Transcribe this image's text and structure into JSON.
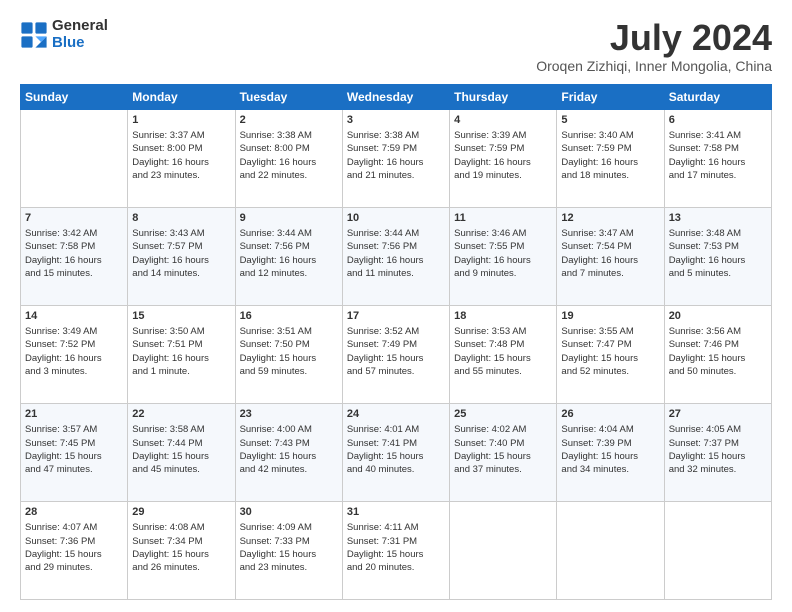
{
  "logo": {
    "text_general": "General",
    "text_blue": "Blue"
  },
  "title": "July 2024",
  "subtitle": "Oroqen Zizhiqi, Inner Mongolia, China",
  "weekdays": [
    "Sunday",
    "Monday",
    "Tuesday",
    "Wednesday",
    "Thursday",
    "Friday",
    "Saturday"
  ],
  "weeks": [
    [
      {
        "day": "",
        "content": ""
      },
      {
        "day": "1",
        "content": "Sunrise: 3:37 AM\nSunset: 8:00 PM\nDaylight: 16 hours\nand 23 minutes."
      },
      {
        "day": "2",
        "content": "Sunrise: 3:38 AM\nSunset: 8:00 PM\nDaylight: 16 hours\nand 22 minutes."
      },
      {
        "day": "3",
        "content": "Sunrise: 3:38 AM\nSunset: 7:59 PM\nDaylight: 16 hours\nand 21 minutes."
      },
      {
        "day": "4",
        "content": "Sunrise: 3:39 AM\nSunset: 7:59 PM\nDaylight: 16 hours\nand 19 minutes."
      },
      {
        "day": "5",
        "content": "Sunrise: 3:40 AM\nSunset: 7:59 PM\nDaylight: 16 hours\nand 18 minutes."
      },
      {
        "day": "6",
        "content": "Sunrise: 3:41 AM\nSunset: 7:58 PM\nDaylight: 16 hours\nand 17 minutes."
      }
    ],
    [
      {
        "day": "7",
        "content": "Sunrise: 3:42 AM\nSunset: 7:58 PM\nDaylight: 16 hours\nand 15 minutes."
      },
      {
        "day": "8",
        "content": "Sunrise: 3:43 AM\nSunset: 7:57 PM\nDaylight: 16 hours\nand 14 minutes."
      },
      {
        "day": "9",
        "content": "Sunrise: 3:44 AM\nSunset: 7:56 PM\nDaylight: 16 hours\nand 12 minutes."
      },
      {
        "day": "10",
        "content": "Sunrise: 3:44 AM\nSunset: 7:56 PM\nDaylight: 16 hours\nand 11 minutes."
      },
      {
        "day": "11",
        "content": "Sunrise: 3:46 AM\nSunset: 7:55 PM\nDaylight: 16 hours\nand 9 minutes."
      },
      {
        "day": "12",
        "content": "Sunrise: 3:47 AM\nSunset: 7:54 PM\nDaylight: 16 hours\nand 7 minutes."
      },
      {
        "day": "13",
        "content": "Sunrise: 3:48 AM\nSunset: 7:53 PM\nDaylight: 16 hours\nand 5 minutes."
      }
    ],
    [
      {
        "day": "14",
        "content": "Sunrise: 3:49 AM\nSunset: 7:52 PM\nDaylight: 16 hours\nand 3 minutes."
      },
      {
        "day": "15",
        "content": "Sunrise: 3:50 AM\nSunset: 7:51 PM\nDaylight: 16 hours\nand 1 minute."
      },
      {
        "day": "16",
        "content": "Sunrise: 3:51 AM\nSunset: 7:50 PM\nDaylight: 15 hours\nand 59 minutes."
      },
      {
        "day": "17",
        "content": "Sunrise: 3:52 AM\nSunset: 7:49 PM\nDaylight: 15 hours\nand 57 minutes."
      },
      {
        "day": "18",
        "content": "Sunrise: 3:53 AM\nSunset: 7:48 PM\nDaylight: 15 hours\nand 55 minutes."
      },
      {
        "day": "19",
        "content": "Sunrise: 3:55 AM\nSunset: 7:47 PM\nDaylight: 15 hours\nand 52 minutes."
      },
      {
        "day": "20",
        "content": "Sunrise: 3:56 AM\nSunset: 7:46 PM\nDaylight: 15 hours\nand 50 minutes."
      }
    ],
    [
      {
        "day": "21",
        "content": "Sunrise: 3:57 AM\nSunset: 7:45 PM\nDaylight: 15 hours\nand 47 minutes."
      },
      {
        "day": "22",
        "content": "Sunrise: 3:58 AM\nSunset: 7:44 PM\nDaylight: 15 hours\nand 45 minutes."
      },
      {
        "day": "23",
        "content": "Sunrise: 4:00 AM\nSunset: 7:43 PM\nDaylight: 15 hours\nand 42 minutes."
      },
      {
        "day": "24",
        "content": "Sunrise: 4:01 AM\nSunset: 7:41 PM\nDaylight: 15 hours\nand 40 minutes."
      },
      {
        "day": "25",
        "content": "Sunrise: 4:02 AM\nSunset: 7:40 PM\nDaylight: 15 hours\nand 37 minutes."
      },
      {
        "day": "26",
        "content": "Sunrise: 4:04 AM\nSunset: 7:39 PM\nDaylight: 15 hours\nand 34 minutes."
      },
      {
        "day": "27",
        "content": "Sunrise: 4:05 AM\nSunset: 7:37 PM\nDaylight: 15 hours\nand 32 minutes."
      }
    ],
    [
      {
        "day": "28",
        "content": "Sunrise: 4:07 AM\nSunset: 7:36 PM\nDaylight: 15 hours\nand 29 minutes."
      },
      {
        "day": "29",
        "content": "Sunrise: 4:08 AM\nSunset: 7:34 PM\nDaylight: 15 hours\nand 26 minutes."
      },
      {
        "day": "30",
        "content": "Sunrise: 4:09 AM\nSunset: 7:33 PM\nDaylight: 15 hours\nand 23 minutes."
      },
      {
        "day": "31",
        "content": "Sunrise: 4:11 AM\nSunset: 7:31 PM\nDaylight: 15 hours\nand 20 minutes."
      },
      {
        "day": "",
        "content": ""
      },
      {
        "day": "",
        "content": ""
      },
      {
        "day": "",
        "content": ""
      }
    ]
  ]
}
